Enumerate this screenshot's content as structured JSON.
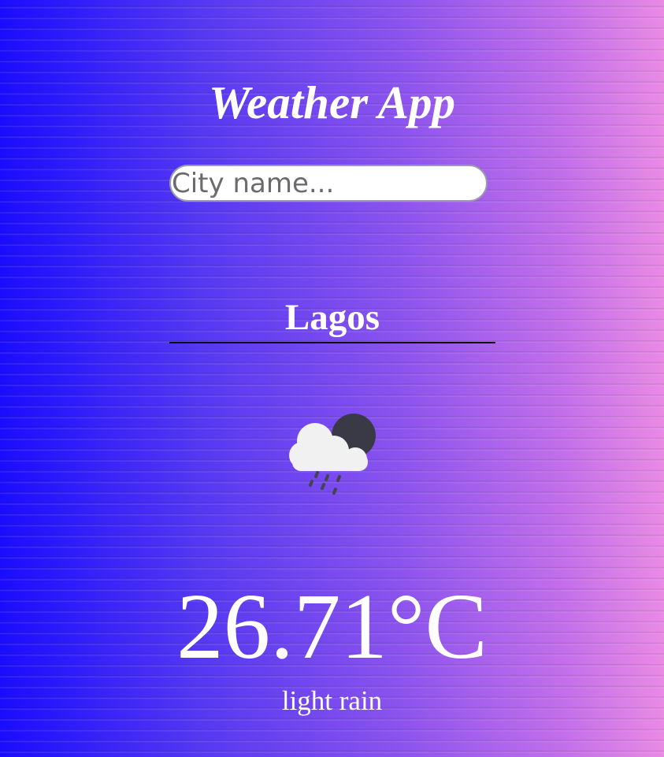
{
  "app": {
    "title": "Weather App"
  },
  "search": {
    "placeholder": "City name...",
    "value": ""
  },
  "weather": {
    "city": "Lagos",
    "icon": "rain-cloud-night-icon",
    "temperature": "26.71°C",
    "description": "light rain"
  },
  "colors": {
    "background_start": "#1a0cff",
    "background_end": "#e98ae5",
    "text": "#ffffff",
    "divider": "#111111"
  }
}
